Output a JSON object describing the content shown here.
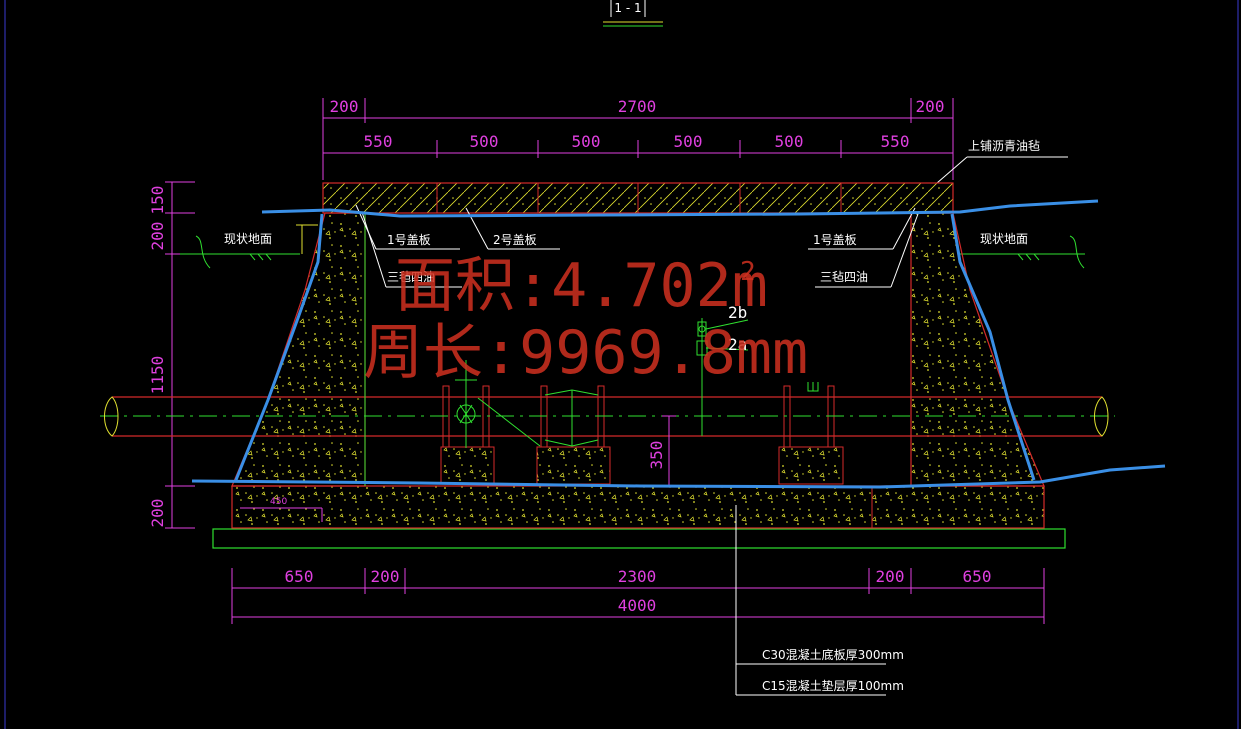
{
  "colors": {
    "background": "#000000",
    "dimension": "#e040e0",
    "structure": "#d42a2a",
    "outline": "#3a8fe6",
    "hatch": "#e0e030",
    "pipe": "#30e030",
    "text": "#ffffff",
    "overlay": "#d03020",
    "base": "#30e030"
  },
  "header": {
    "section_label": "1 - 1"
  },
  "dimensions": {
    "top_edge": [
      "200",
      "2700",
      "200"
    ],
    "top_segments": [
      "550",
      "500",
      "500",
      "500",
      "500",
      "550"
    ],
    "bottom_segments": [
      "650",
      "200",
      "2300",
      "200",
      "650"
    ],
    "bottom_total": "4000",
    "left_vertical": [
      "150",
      "200",
      "1150",
      "200"
    ],
    "pipe_height": "350",
    "slope_mark": "450"
  },
  "labels": {
    "top_coating": "上铺沥青油毡",
    "existing_ground_left": "现状地面",
    "existing_ground_right": "现状地面",
    "cover_plate_1_left": "1号盖板",
    "cover_plate_2": "2号盖板",
    "cover_plate_1_right": "1号盖板",
    "felt_left": "三毡四油",
    "felt_right": "三毡四油",
    "pipe_2b": "2b",
    "pipe_2a": "2a",
    "bottom_slab": "C30混凝土底板厚300mm",
    "cushion_layer": "C15混凝土垫层厚100mm"
  },
  "overlay": {
    "area": "面积:4.702m",
    "area_superscript": "2",
    "perimeter": "周长:9969.8mm"
  }
}
